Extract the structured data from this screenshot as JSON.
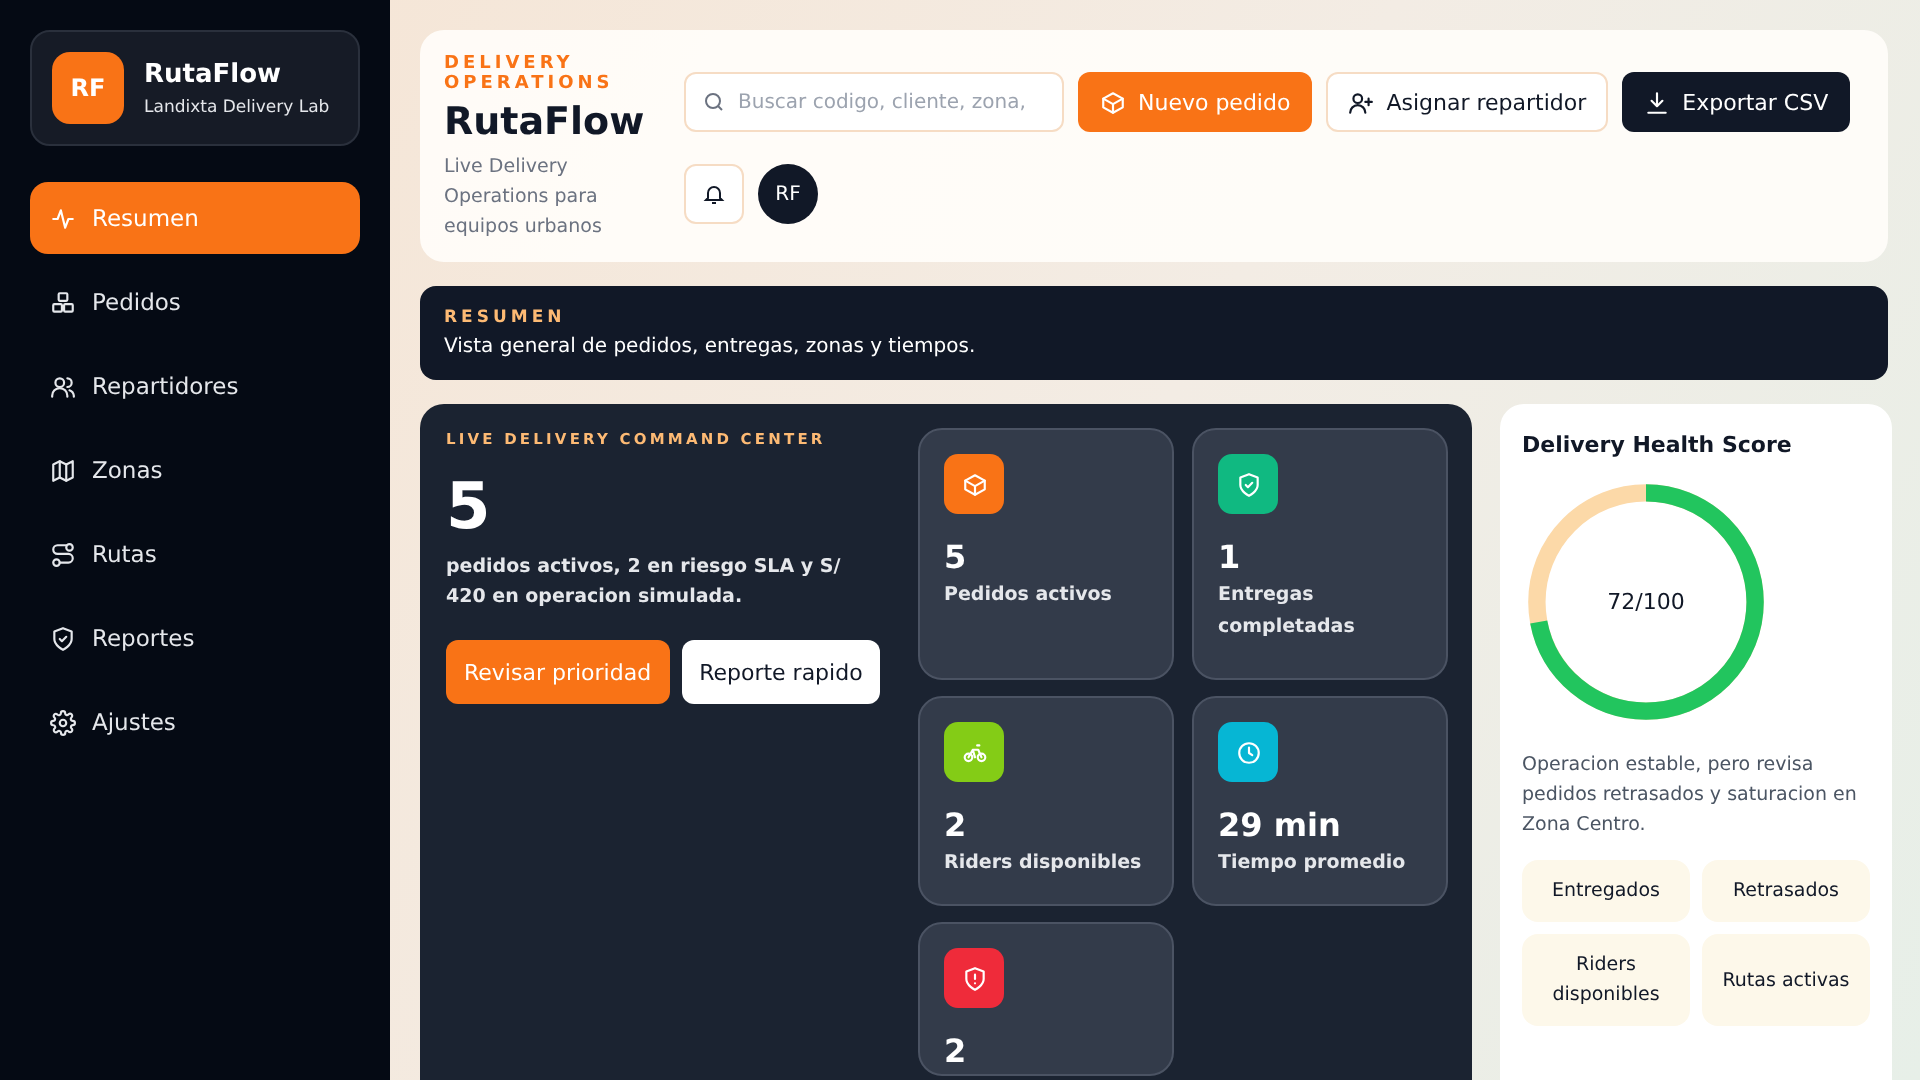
{
  "brand": {
    "initials": "RF",
    "name": "RutaFlow",
    "subtitle": "Landixta Delivery Lab"
  },
  "nav": [
    {
      "label": "Resumen",
      "selected": true
    },
    {
      "label": "Pedidos",
      "selected": false
    },
    {
      "label": "Repartidores",
      "selected": false
    },
    {
      "label": "Zonas",
      "selected": false
    },
    {
      "label": "Rutas",
      "selected": false
    },
    {
      "label": "Reportes",
      "selected": false
    },
    {
      "label": "Ajustes",
      "selected": false
    }
  ],
  "header": {
    "eyebrow": "DELIVERY OPERATIONS",
    "title": "RutaFlow",
    "subtitle": "Live Delivery Operations para equipos urbanos",
    "search": {
      "placeholder": "Buscar codigo, cliente, zona,"
    },
    "buttons": [
      {
        "label": "Nuevo pedido",
        "kind": "primary"
      },
      {
        "label": "Asignar repartidor",
        "kind": "outline"
      },
      {
        "label": "Exportar CSV",
        "kind": "dark"
      }
    ],
    "avatar": "RF"
  },
  "summary": {
    "eyebrow": "RESUMEN",
    "text": "Vista general de pedidos, entregas, zonas y tiempos."
  },
  "command": {
    "eyebrow": "LIVE DELIVERY COMMAND CENTER",
    "value": "5",
    "text": "pedidos activos, 2 en riesgo SLA y S/ 420 en operacion simulada.",
    "buttons": [
      {
        "label": "Revisar prioridad",
        "kind": "primary"
      },
      {
        "label": "Reporte rapido",
        "kind": "light"
      }
    ],
    "stats": [
      {
        "value": "5",
        "label": "Pedidos activos",
        "color": "#f97316"
      },
      {
        "value": "1",
        "label": "Entregas completadas",
        "color": "#10b981"
      },
      {
        "value": "2",
        "label": "Riders disponibles",
        "color": "#84cc16"
      },
      {
        "value": "29 min",
        "label": "Tiempo promedio",
        "color": "#06b6d4"
      },
      {
        "value": "2",
        "color": "#ef2b3a"
      }
    ]
  },
  "health": {
    "title": "Delivery Health Score",
    "score": "72/100",
    "level": 0.72,
    "note": "Operacion estable, pero revisa pedidos retrasados y saturacion en Zona Centro.",
    "chips": [
      "Entregados",
      "Retrasados",
      "Riders disponibles",
      "Rutas activas"
    ]
  }
}
